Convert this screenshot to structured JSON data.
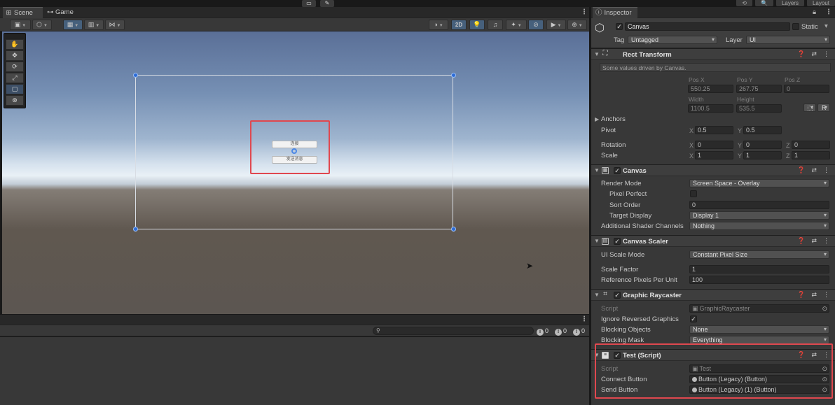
{
  "colors": {
    "highlight": "#e0484f",
    "accent": "#2d6cd6",
    "panel": "#383838",
    "header": "#3e3e3e",
    "field": "#2a2a2a"
  },
  "top": {
    "tools": [
      {
        "icon": "rect-tool-icon",
        "glyph": "▭"
      },
      {
        "icon": "pen-edit-icon",
        "glyph": "✎"
      }
    ],
    "right_buttons": [
      "⟲",
      "🔍",
      "Layers",
      "Layout"
    ]
  },
  "scene_window": {
    "tabs": [
      {
        "label": "Scene",
        "icon": "scene-grid-icon",
        "glyph": "⊞"
      },
      {
        "label": "Game",
        "icon": "gamepad-icon",
        "glyph": "⊶"
      }
    ],
    "toolbar_left": [
      {
        "name": "draw-mode-dropdown",
        "glyph": "▣"
      },
      {
        "name": "cube-view-dropdown",
        "glyph": "⬡"
      },
      {
        "name": "gizmo-grid-dropdown",
        "glyph": "▦"
      },
      {
        "name": "snap-grid-dropdown",
        "glyph": "▥"
      },
      {
        "name": "increment-snap-dropdown",
        "glyph": "⋈"
      }
    ],
    "toolbar_right": [
      {
        "name": "shading-mode-dropdown",
        "glyph": "◑"
      },
      {
        "name": "2d-toggle",
        "glyph": "2D"
      },
      {
        "name": "lighting-toggle",
        "glyph": "💡"
      },
      {
        "name": "audio-toggle",
        "glyph": "♫"
      },
      {
        "name": "effects-dropdown",
        "glyph": "✦"
      },
      {
        "name": "hidden-objects-toggle",
        "glyph": "⊘"
      },
      {
        "name": "camera-dropdown",
        "glyph": "▶"
      },
      {
        "name": "gizmos-dropdown",
        "glyph": "⊕"
      }
    ],
    "tools": [
      {
        "name": "hand-tool",
        "glyph": "✋"
      },
      {
        "name": "move-tool",
        "glyph": "✥"
      },
      {
        "name": "rotate-tool",
        "glyph": "⟳"
      },
      {
        "name": "scale-tool",
        "glyph": "⤢"
      },
      {
        "name": "rect-tool",
        "glyph": "▢"
      },
      {
        "name": "transform-tool",
        "glyph": "⊛"
      }
    ],
    "ui_buttons": [
      "连接",
      "发送消息"
    ]
  },
  "console": {
    "counts": {
      "log": "0",
      "warning": "0",
      "error": "0"
    }
  },
  "inspector": {
    "tab_label": "Inspector",
    "object": {
      "name": "Canvas",
      "static_label": "Static",
      "tag_label": "Tag",
      "tag": "Untagged",
      "layer_label": "Layer",
      "layer": "UI"
    },
    "rect_transform": {
      "title": "Rect Transform",
      "note": "Some values driven by Canvas.",
      "headers": {
        "pos_x": "Pos X",
        "pos_y": "Pos Y",
        "pos_z": "Pos Z",
        "width": "Width",
        "height": "Height"
      },
      "pos_x": "550.25",
      "pos_y": "267.75",
      "pos_z": "0",
      "width": "1100.5",
      "height": "535.5",
      "anchors_label": "Anchors",
      "pivot_label": "Pivot",
      "pivot_x": "0.5",
      "pivot_y": "0.5",
      "rotation_label": "Rotation",
      "rot_x": "0",
      "rot_y": "0",
      "rot_z": "0",
      "scale_label": "Scale",
      "scale_x": "1",
      "scale_y": "1",
      "scale_z": "1",
      "axis_x": "X",
      "axis_y": "Y",
      "axis_z": "Z",
      "btn_blueprint": "⬚",
      "btn_raw": "R"
    },
    "canvas": {
      "title": "Canvas",
      "render_mode_label": "Render Mode",
      "render_mode": "Screen Space - Overlay",
      "pixel_perfect_label": "Pixel Perfect",
      "sort_order_label": "Sort Order",
      "sort_order": "0",
      "target_display_label": "Target Display",
      "target_display": "Display 1",
      "shader_channels_label": "Additional Shader Channels",
      "shader_channels": "Nothing"
    },
    "canvas_scaler": {
      "title": "Canvas Scaler",
      "scale_mode_label": "UI Scale Mode",
      "scale_mode": "Constant Pixel Size",
      "scale_factor_label": "Scale Factor",
      "scale_factor": "1",
      "ref_ppu_label": "Reference Pixels Per Unit",
      "ref_ppu": "100"
    },
    "graphic_raycaster": {
      "title": "Graphic Raycaster",
      "script_label": "Script",
      "script": "GraphicRaycaster",
      "ignore_reversed_label": "Ignore Reversed Graphics",
      "blocking_objects_label": "Blocking Objects",
      "blocking_objects": "None",
      "blocking_mask_label": "Blocking Mask",
      "blocking_mask": "Everything"
    },
    "test_script": {
      "title": "Test (Script)",
      "script_label": "Script",
      "script": "Test",
      "connect_label": "Connect Button",
      "connect": "Button (Legacy) (Button)",
      "send_label": "Send Button",
      "send": "Button (Legacy) (1) (Button)"
    },
    "header_icons": [
      "❓",
      "⇄",
      "⋮"
    ]
  }
}
